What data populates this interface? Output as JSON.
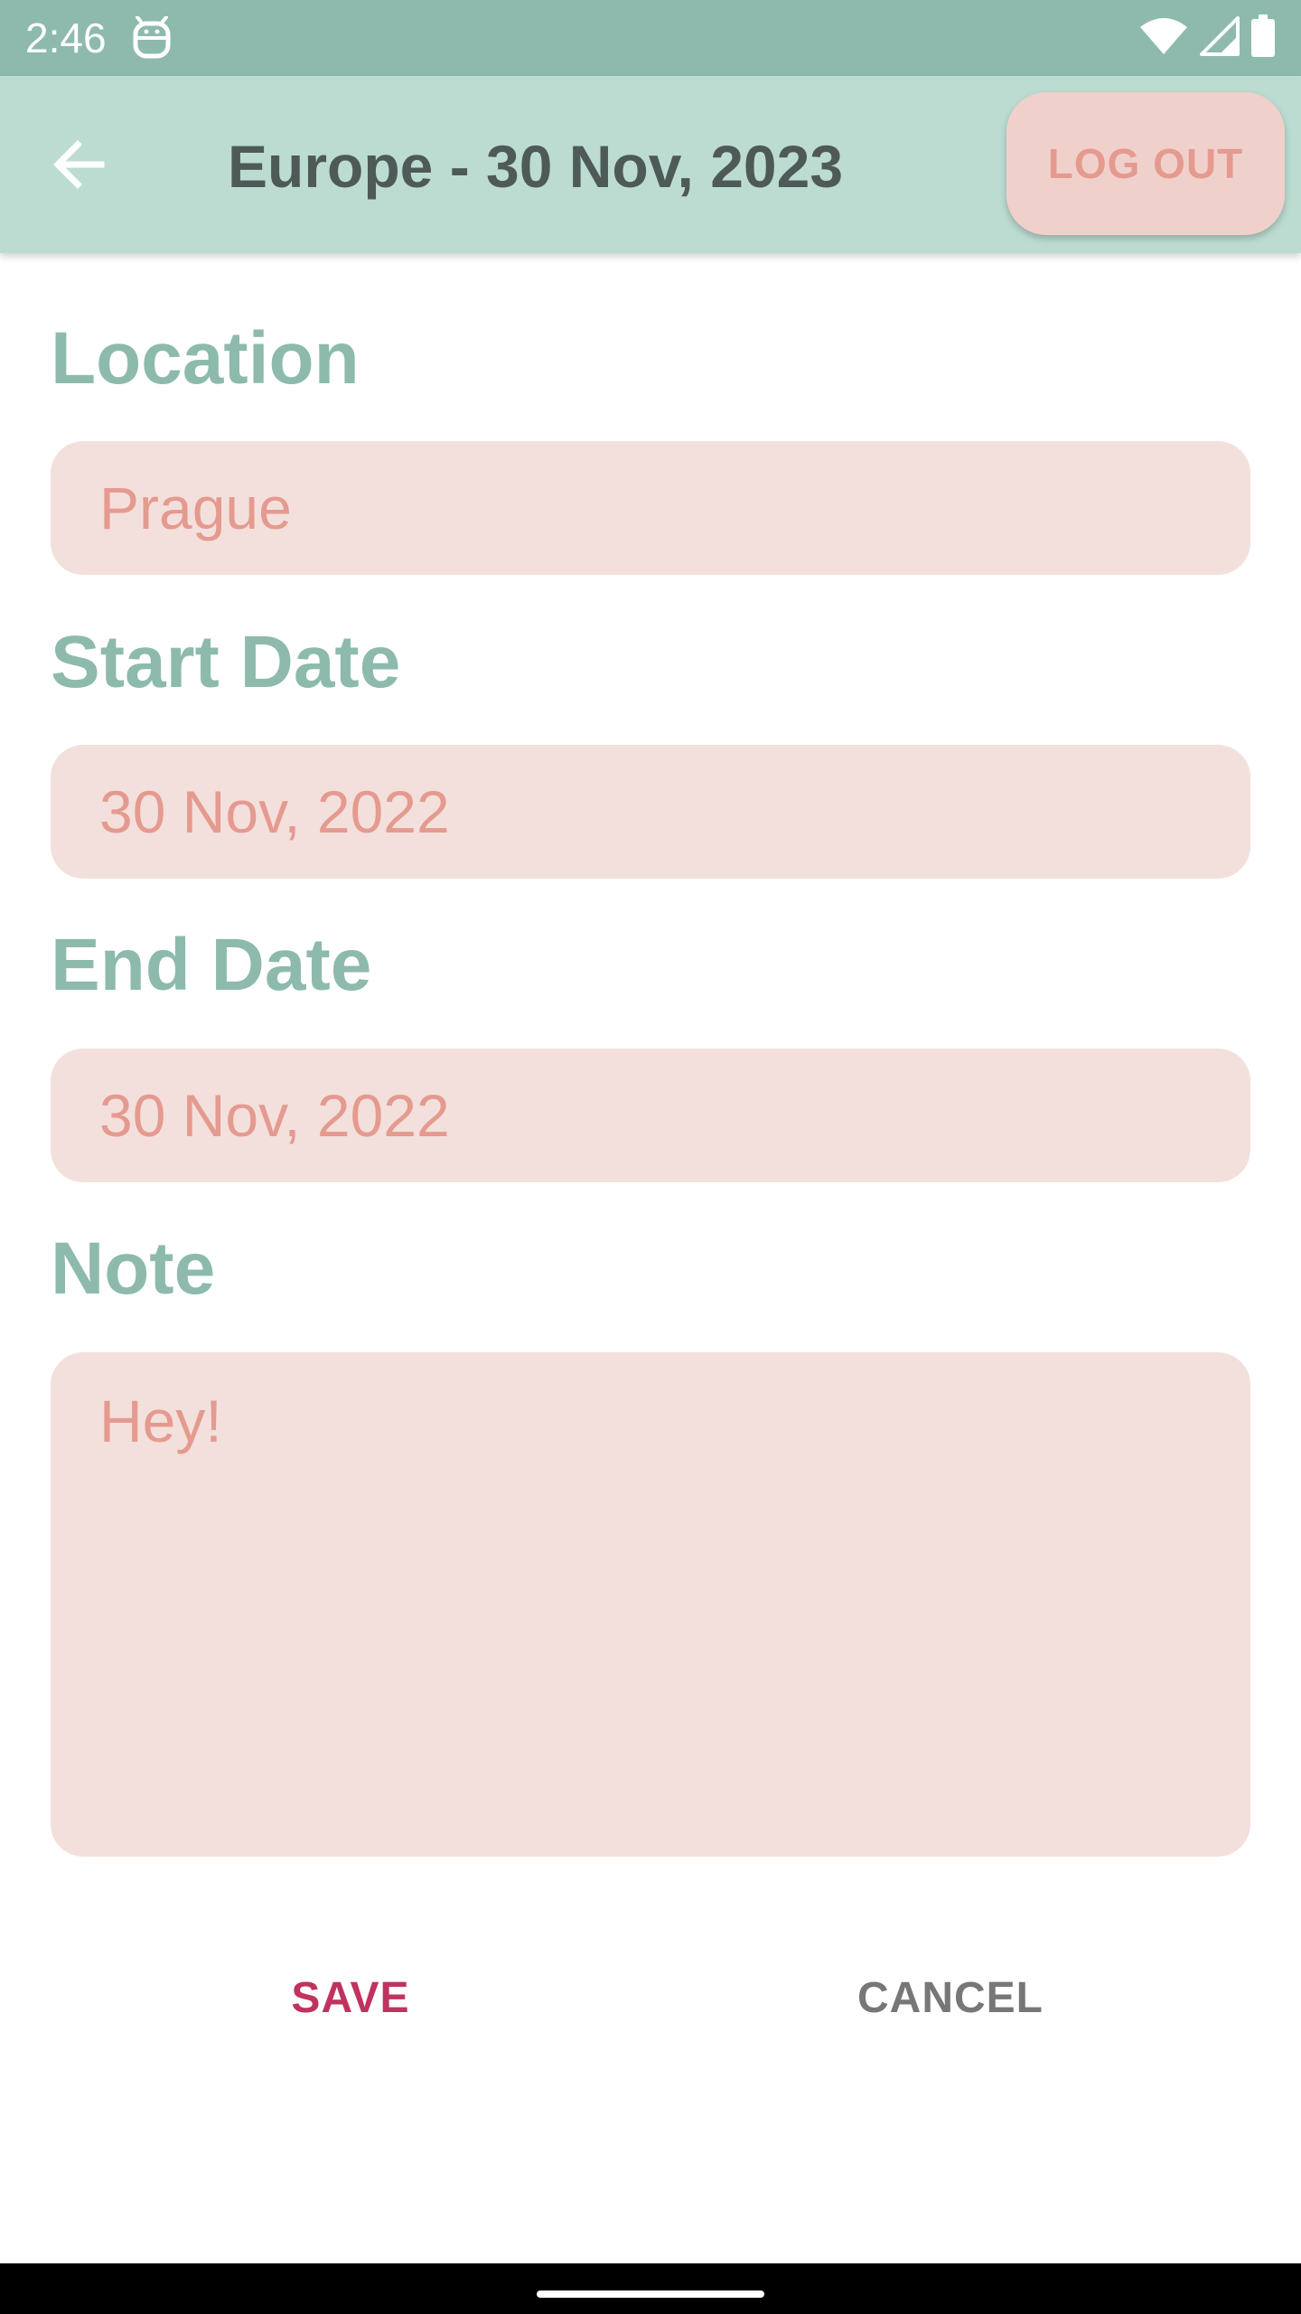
{
  "status_bar": {
    "time": "2:46",
    "icons": [
      "robot-icon",
      "wifi-icon",
      "signal-icon",
      "battery-icon"
    ]
  },
  "app_bar": {
    "back_icon": "arrow-back-icon",
    "title": "Europe - 30 Nov, 2023",
    "logout_label": "LOG OUT"
  },
  "form": {
    "location": {
      "label": "Location",
      "value": "Prague"
    },
    "start_date": {
      "label": "Start Date",
      "value": "30 Nov, 2022"
    },
    "end_date": {
      "label": "End Date",
      "value": "30 Nov, 2022"
    },
    "note": {
      "label": "Note",
      "value": "Hey!"
    }
  },
  "actions": {
    "save_label": "SAVE",
    "cancel_label": "CANCEL"
  },
  "colors": {
    "status_bar": "#8dbaad",
    "app_bar": "#bcdcd2",
    "label": "#8dbaad",
    "field_bg": "#f3e0dc",
    "field_text": "#e59a90",
    "save": "#c0335e",
    "cancel": "#777777"
  }
}
